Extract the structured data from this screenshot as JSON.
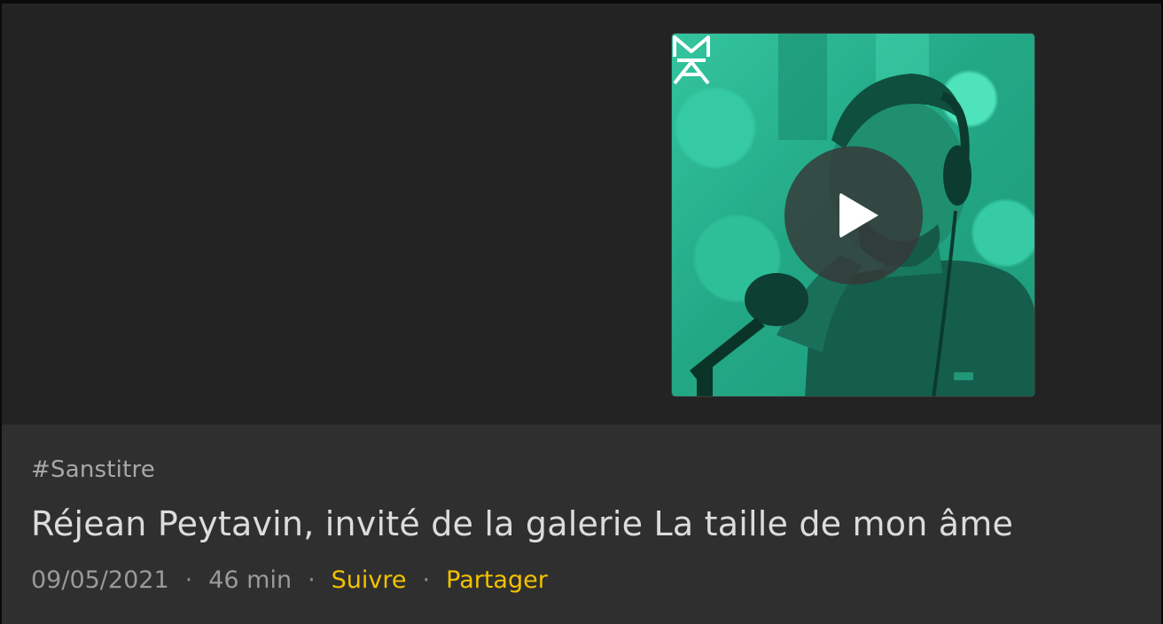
{
  "episode": {
    "tag": "#Sanstitre",
    "title": "Réjean Peytavin, invité de la galerie La taille de mon âme",
    "date": "09/05/2021",
    "duration": "46 min",
    "separator": "·",
    "follow_label": "Suivre",
    "share_label": "Partager"
  },
  "cover": {
    "icons": {
      "logo": "ma-logo-icon",
      "play": "play-icon"
    },
    "tint_color": "#2bbd96"
  },
  "colors": {
    "background": "#232323",
    "info_background": "#2f2f2f",
    "accent": "#f2c200",
    "title": "#dcdcdc",
    "muted": "#9a9a9a"
  }
}
